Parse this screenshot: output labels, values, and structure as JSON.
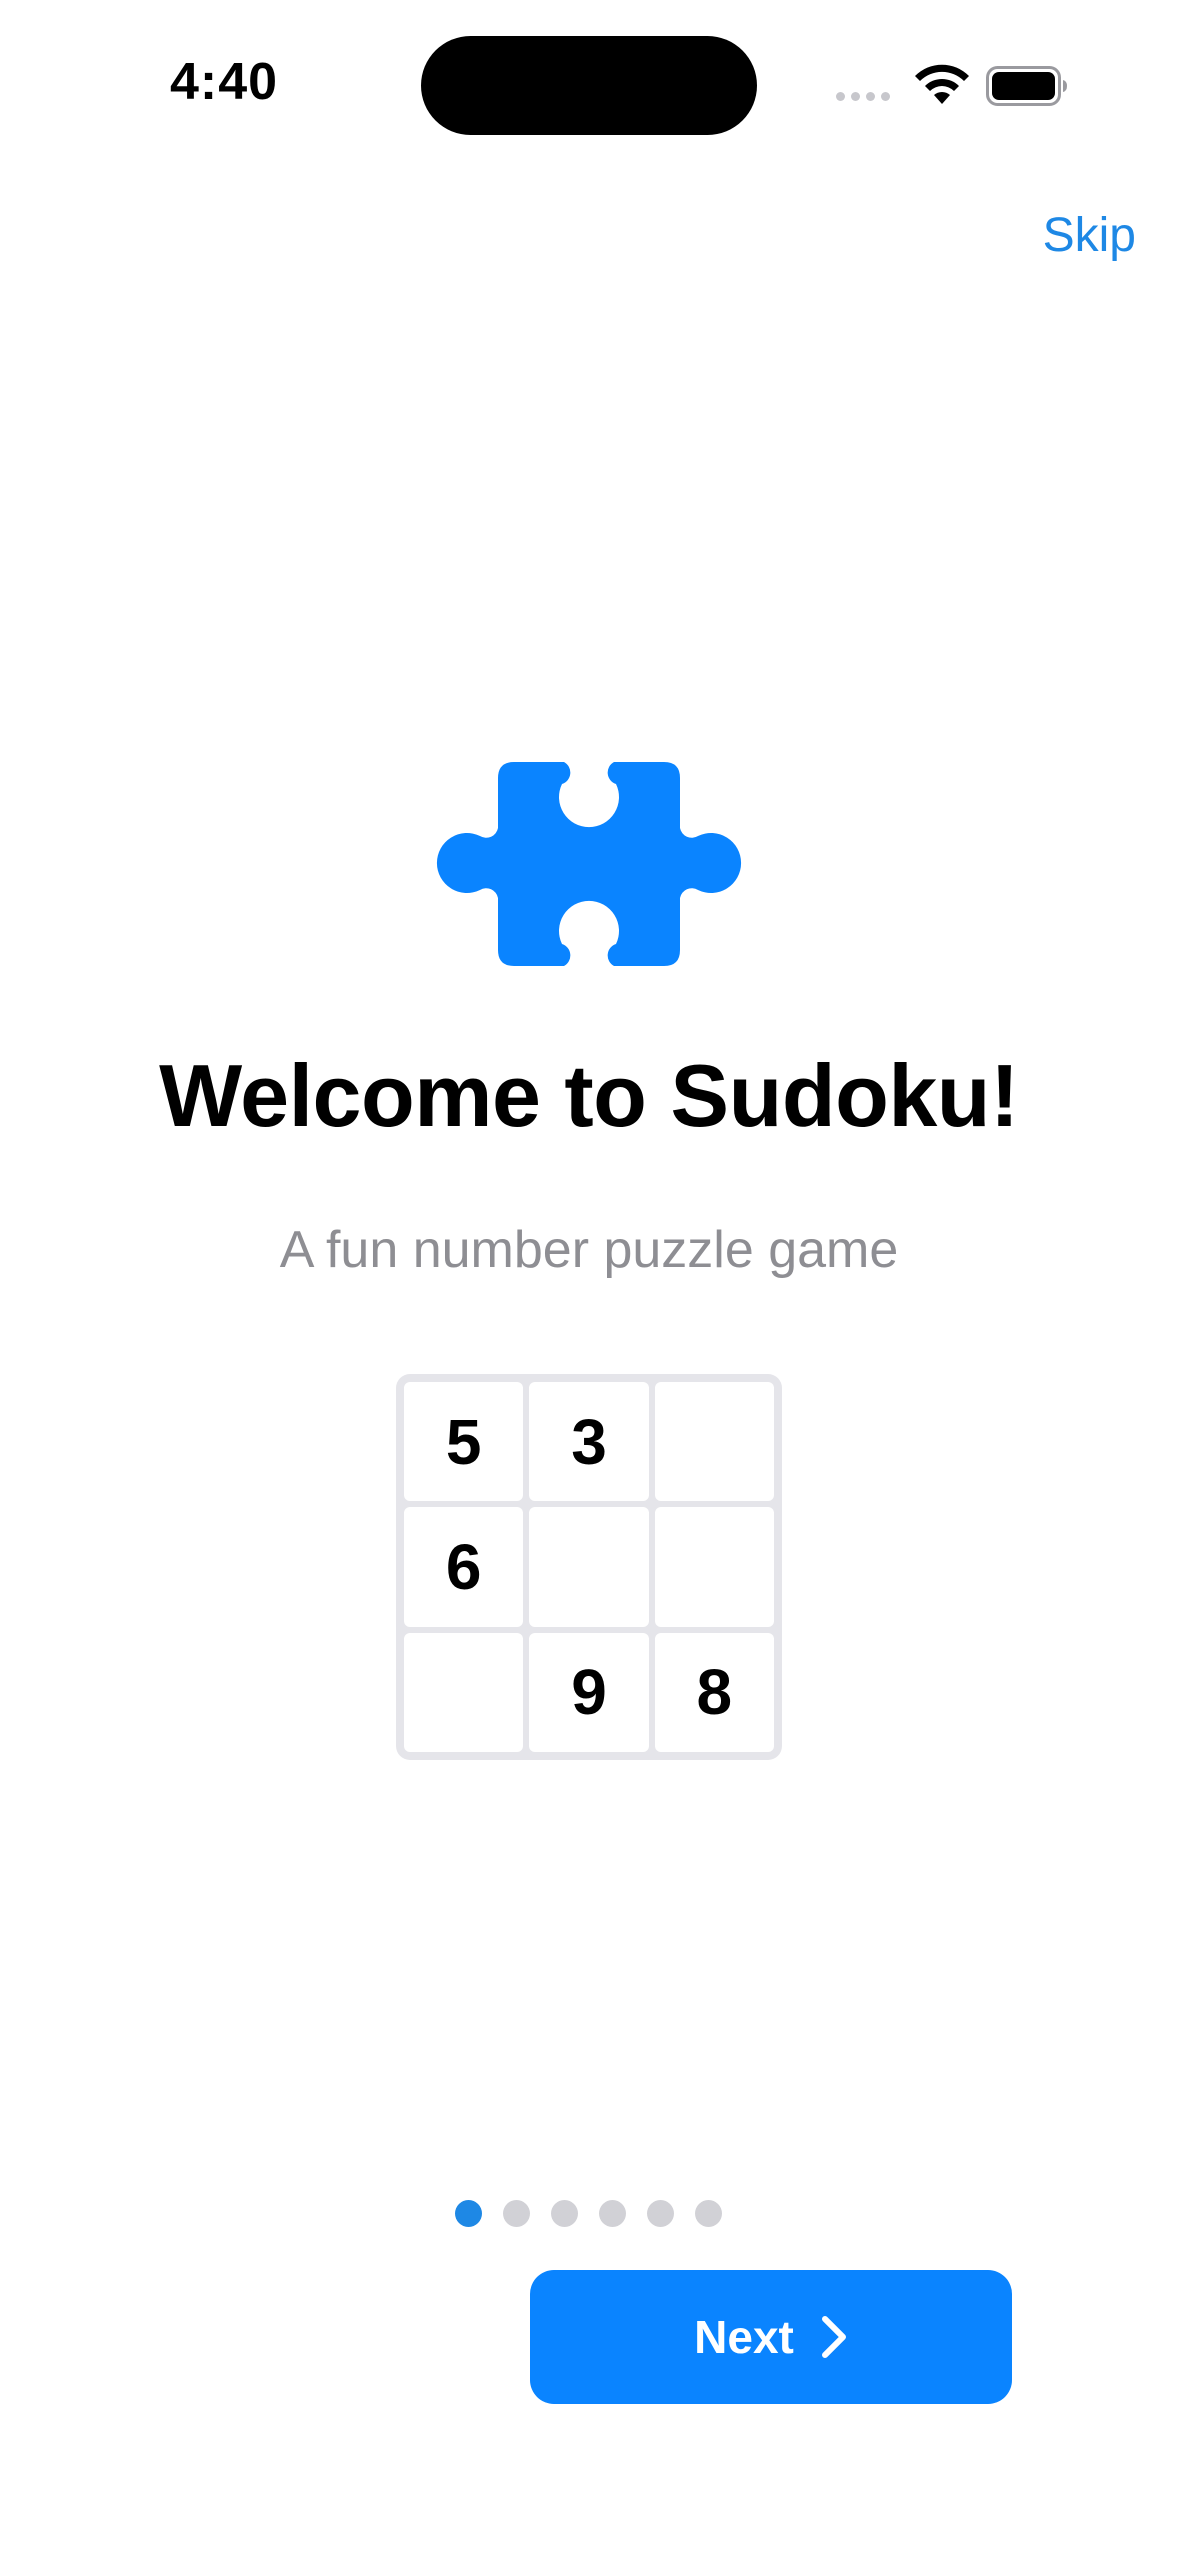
{
  "status_bar": {
    "time": "4:40"
  },
  "header": {
    "skip_label": "Skip"
  },
  "onboarding": {
    "icon": "puzzle-piece-icon",
    "title": "Welcome to Sudoku!",
    "subtitle": "A fun number puzzle game",
    "grid": [
      [
        "5",
        "3",
        ""
      ],
      [
        "6",
        "",
        ""
      ],
      [
        "",
        "9",
        "8"
      ]
    ],
    "page_count": 6,
    "current_page": 1
  },
  "footer": {
    "next_label": "Next"
  },
  "colors": {
    "accent": "#0A84FF",
    "link": "#1E88E5",
    "subtitle": "#8E8E93",
    "dot_inactive": "#D1D1D6",
    "grid_border": "#E5E5EA"
  }
}
